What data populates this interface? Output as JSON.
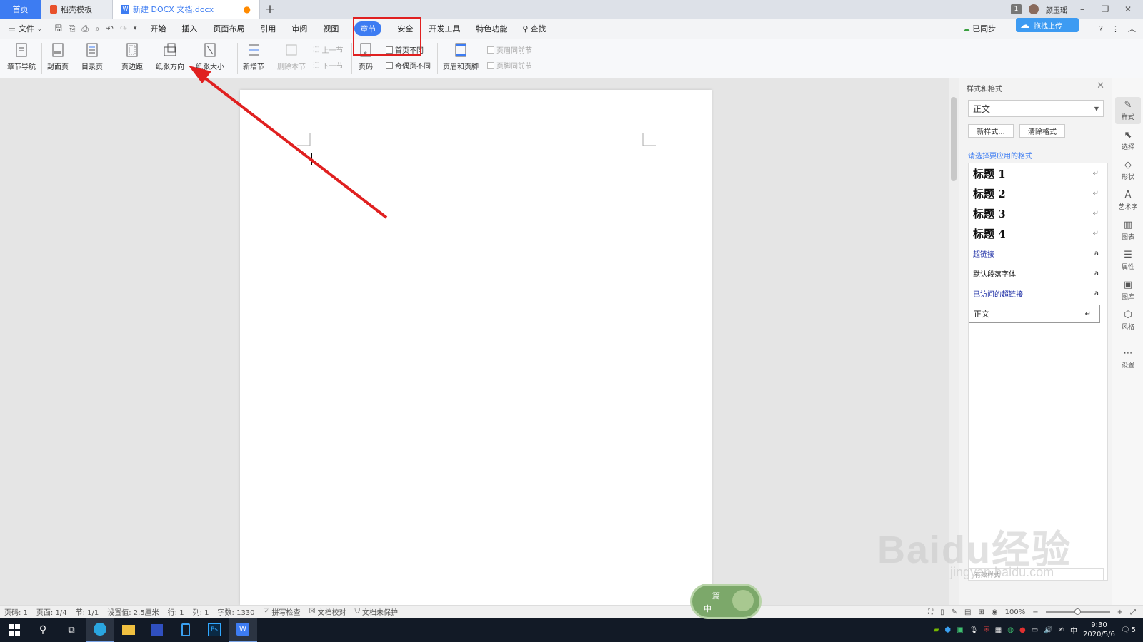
{
  "tabs": {
    "home": "首页",
    "template": "稻壳模板",
    "document": "新建 DOCX 文档.docx",
    "new_tab": "+"
  },
  "topbar": {
    "badge_count": "1",
    "user_name": "颜玉瑶",
    "cloud_upload": "拖拽上传"
  },
  "menu": {
    "file": "文件",
    "items": [
      "开始",
      "插入",
      "页面布局",
      "引用",
      "审阅",
      "视图",
      "章节",
      "安全",
      "开发工具",
      "特色功能"
    ],
    "search": "查找",
    "sync": "已同步"
  },
  "ribbon": {
    "section_nav": "章节导航",
    "cover_page": "封面页",
    "toc_page": "目录页",
    "margins": "页边距",
    "orientation": "纸张方向",
    "paper_size": "纸张大小",
    "new_section": "新增节",
    "delete_section": "删除本节",
    "prev_section": "上一节",
    "next_section": "下一节",
    "page_number": "页码",
    "first_page_diff": "首页不同",
    "odd_even_diff": "奇偶页不同",
    "header_footer": "页眉和页脚",
    "header_same_prev": "页眉同前节",
    "footer_same_prev": "页脚同前节"
  },
  "panel": {
    "title": "样式和格式",
    "current_style": "正文",
    "new_style": "新样式...",
    "clear_format": "清除格式",
    "hint": "请选择要应用的格式",
    "styles": [
      {
        "label": "标题  1",
        "type": "heading",
        "mark": "↵"
      },
      {
        "label": "标题  2",
        "type": "heading",
        "mark": "↵"
      },
      {
        "label": "标题  3",
        "type": "heading",
        "mark": "↵"
      },
      {
        "label": "标题  4",
        "type": "heading",
        "mark": "↵"
      },
      {
        "label": "超链接",
        "type": "link",
        "mark": "a"
      },
      {
        "label": "默认段落字体",
        "type": "normal",
        "mark": "a"
      },
      {
        "label": "已访问的超链接",
        "type": "link",
        "mark": "a"
      },
      {
        "label": "正文",
        "type": "selected",
        "mark": "↵"
      }
    ],
    "bottom_partial": "有效样式"
  },
  "right_tools": [
    "样式",
    "选择",
    "形状",
    "艺术字",
    "图表",
    "属性",
    "图库",
    "风格",
    "设置"
  ],
  "status": {
    "page_no": "页码: 1",
    "pages": "页面: 1/4",
    "section": "节: 1/1",
    "setting": "设置值: 2.5厘米",
    "row": "行: 1",
    "col": "列: 1",
    "words": "字数: 1330",
    "spell": "拼写检查",
    "proof": "文档校对",
    "protect": "文档未保护",
    "zoom": "100%"
  },
  "taskbar": {
    "time": "9:30",
    "date": "2020/5/6",
    "ime": "中",
    "notification_count": "5"
  },
  "float_widget": {
    "top": "篇",
    "bottom": "中"
  },
  "watermark": {
    "main": "Baidu经验",
    "sub": "jingyan.baidu.com"
  },
  "colors": {
    "accent": "#3d7cf2",
    "annotation_red": "#e02020"
  }
}
